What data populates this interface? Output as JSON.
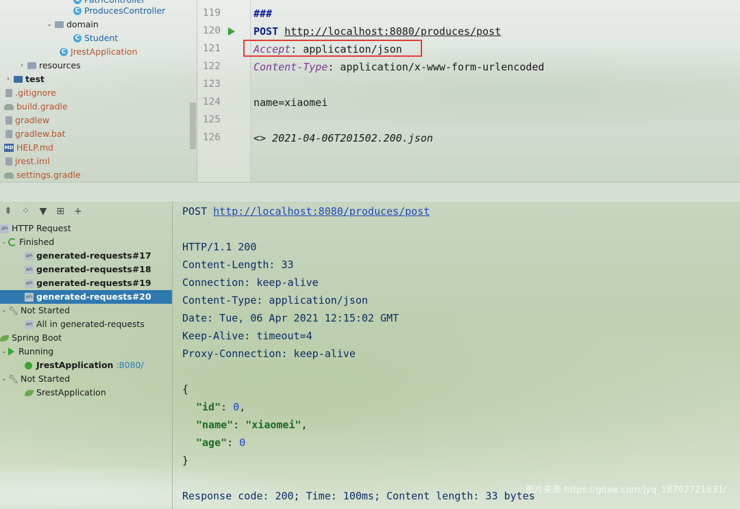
{
  "project_tree": {
    "items": [
      {
        "label": "PathController",
        "icon": "class-icon"
      },
      {
        "label": "ProducesController",
        "icon": "class-icon"
      },
      {
        "label": "domain",
        "icon": "folder-icon"
      },
      {
        "label": "Student",
        "icon": "class-icon"
      },
      {
        "label": "JrestApplication",
        "icon": "class-icon"
      },
      {
        "label": "resources",
        "icon": "folder-icon"
      },
      {
        "label": "test",
        "icon": "folder-icon"
      },
      {
        "label": ".gitignore",
        "icon": "file-icon"
      },
      {
        "label": "build.gradle",
        "icon": "gradle-icon"
      },
      {
        "label": "gradlew",
        "icon": "file-icon"
      },
      {
        "label": "gradlew.bat",
        "icon": "file-icon"
      },
      {
        "label": "HELP.md",
        "icon": "markdown-icon"
      },
      {
        "label": "jrest.iml",
        "icon": "file-icon"
      },
      {
        "label": "settings.gradle",
        "icon": "gradle-icon"
      }
    ]
  },
  "editor": {
    "line_numbers": [
      "119",
      "120",
      "121",
      "122",
      "123",
      "124",
      "125",
      "126"
    ],
    "lines": {
      "l119": "###",
      "method": "POST",
      "url": "http://localhost:8080/produces/post",
      "accept_key": "Accept",
      "accept_value": ": application/json",
      "ct_key": "Content-Type",
      "ct_value": ": application/x-www-form-urlencoded",
      "body": "name=xiaomei",
      "response_ref_prefix": "<> ",
      "response_ref_file": "2021-04-06T201502.200.json"
    }
  },
  "services": {
    "toolbar": [
      "collapse-icon",
      "group-icon",
      "filter-icon",
      "new-service-icon",
      "add-icon"
    ],
    "http_request": "HTTP Request",
    "finished": "Finished",
    "requests": [
      "generated-requests#17",
      "generated-requests#18",
      "generated-requests#19",
      "generated-requests#20"
    ],
    "not_started": "Not Started",
    "all_in": "All in generated-requests",
    "spring_boot": "Spring Boot",
    "running": "Running",
    "jrest_app": "JrestApplication",
    "jrest_port": ":8080/",
    "not_started_2": "Not Started",
    "srest_app": "SrestApplication"
  },
  "response": {
    "method": "POST ",
    "url": "http://localhost:8080/produces/post",
    "status_line": "HTTP/1.1 200",
    "headers": [
      "Content-Length: 33",
      "Connection: keep-alive",
      "Content-Type: application/json",
      "Date: Tue, 06 Apr 2021 12:15:02 GMT",
      "Keep-Alive: timeout=4",
      "Proxy-Connection: keep-alive"
    ],
    "json_open": "{",
    "json_close": "}",
    "fields": {
      "id_key": "\"id\"",
      "id_val": "0",
      "name_key": "\"name\"",
      "name_val": "\"xiaomei\"",
      "age_key": "\"age\"",
      "age_val": "0"
    },
    "summary": "Response code: 200; Time: 100ms; Content length: 33 bytes",
    "watermark": "图片来源 https://gitee.com/jyq_18792721831/"
  }
}
